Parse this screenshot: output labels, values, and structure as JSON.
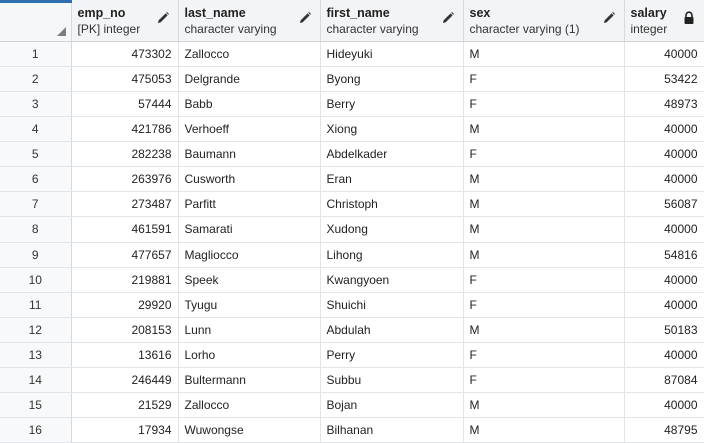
{
  "columns": [
    {
      "name": "emp_no",
      "type": "[PK] integer",
      "icon": "pencil-icon"
    },
    {
      "name": "last_name",
      "type": "character varying",
      "icon": "pencil-icon"
    },
    {
      "name": "first_name",
      "type": "character varying",
      "icon": "pencil-icon"
    },
    {
      "name": "sex",
      "type": "character varying (1)",
      "icon": "pencil-icon"
    },
    {
      "name": "salary",
      "type": "integer",
      "icon": "lock-icon"
    }
  ],
  "rows": [
    {
      "n": "1",
      "emp_no": "473302",
      "last_name": "Zallocco",
      "first_name": "Hideyuki",
      "sex": "M",
      "salary": "40000"
    },
    {
      "n": "2",
      "emp_no": "475053",
      "last_name": "Delgrande",
      "first_name": "Byong",
      "sex": "F",
      "salary": "53422"
    },
    {
      "n": "3",
      "emp_no": "57444",
      "last_name": "Babb",
      "first_name": "Berry",
      "sex": "F",
      "salary": "48973"
    },
    {
      "n": "4",
      "emp_no": "421786",
      "last_name": "Verhoeff",
      "first_name": "Xiong",
      "sex": "M",
      "salary": "40000"
    },
    {
      "n": "5",
      "emp_no": "282238",
      "last_name": "Baumann",
      "first_name": "Abdelkader",
      "sex": "F",
      "salary": "40000"
    },
    {
      "n": "6",
      "emp_no": "263976",
      "last_name": "Cusworth",
      "first_name": "Eran",
      "sex": "M",
      "salary": "40000"
    },
    {
      "n": "7",
      "emp_no": "273487",
      "last_name": "Parfitt",
      "first_name": "Christoph",
      "sex": "M",
      "salary": "56087"
    },
    {
      "n": "8",
      "emp_no": "461591",
      "last_name": "Samarati",
      "first_name": "Xudong",
      "sex": "M",
      "salary": "40000"
    },
    {
      "n": "9",
      "emp_no": "477657",
      "last_name": "Magliocco",
      "first_name": "Lihong",
      "sex": "M",
      "salary": "54816"
    },
    {
      "n": "10",
      "emp_no": "219881",
      "last_name": "Speek",
      "first_name": "Kwangyoen",
      "sex": "F",
      "salary": "40000"
    },
    {
      "n": "11",
      "emp_no": "29920",
      "last_name": "Tyugu",
      "first_name": "Shuichi",
      "sex": "F",
      "salary": "40000"
    },
    {
      "n": "12",
      "emp_no": "208153",
      "last_name": "Lunn",
      "first_name": "Abdulah",
      "sex": "M",
      "salary": "50183"
    },
    {
      "n": "13",
      "emp_no": "13616",
      "last_name": "Lorho",
      "first_name": "Perry",
      "sex": "F",
      "salary": "40000"
    },
    {
      "n": "14",
      "emp_no": "246449",
      "last_name": "Bultermann",
      "first_name": "Subbu",
      "sex": "F",
      "salary": "87084"
    },
    {
      "n": "15",
      "emp_no": "21529",
      "last_name": "Zallocco",
      "first_name": "Bojan",
      "sex": "M",
      "salary": "40000"
    },
    {
      "n": "16",
      "emp_no": "17934",
      "last_name": "Wuwongse",
      "first_name": "Bilhanan",
      "sex": "M",
      "salary": "48795"
    }
  ],
  "colors": {
    "header_bg": "#f3f4f6",
    "accent": "#2f6fb0",
    "grid_line": "#e1e4e8"
  }
}
